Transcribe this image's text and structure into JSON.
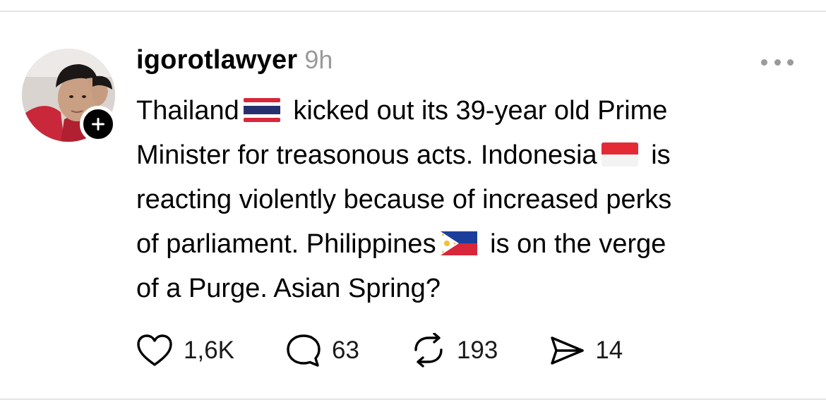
{
  "post": {
    "username": "igorotlawyer",
    "timestamp": "9h",
    "body_lines": [
      {
        "segments": [
          {
            "type": "text",
            "value": "Thailand"
          },
          {
            "type": "flag",
            "icon": "thailand-flag-icon"
          },
          {
            "type": "text",
            "value": " kicked out its 39-year old Prime"
          }
        ]
      },
      {
        "segments": [
          {
            "type": "text",
            "value": "Minister for treasonous acts. Indonesia"
          },
          {
            "type": "flag",
            "icon": "indonesia-flag-icon"
          },
          {
            "type": "text",
            "value": " is"
          }
        ]
      },
      {
        "segments": [
          {
            "type": "text",
            "value": "reacting violently because of increased perks"
          }
        ]
      },
      {
        "segments": [
          {
            "type": "text",
            "value": "of parliament. Philippines"
          },
          {
            "type": "flag",
            "icon": "philippines-flag-icon"
          },
          {
            "type": "text",
            "value": " is on the verge"
          }
        ]
      },
      {
        "segments": [
          {
            "type": "text",
            "value": "of a Purge. Asian Spring?"
          }
        ]
      }
    ],
    "line1_a": "Thailand",
    "line1_b": " kicked out its 39-year old Prime",
    "line2_a": "Minister for treasonous acts. Indonesia",
    "line2_b": " is",
    "line3": "reacting violently because of increased perks",
    "line4_a": "of parliament. Philippines",
    "line4_b": " is on the verge",
    "line5": "of a Purge. Asian Spring?"
  },
  "actions": {
    "like": {
      "icon": "heart-icon",
      "count": "1,6K"
    },
    "comment": {
      "icon": "comment-icon",
      "count": "63"
    },
    "repost": {
      "icon": "repost-icon",
      "count": "193"
    },
    "share": {
      "icon": "send-icon",
      "count": "14"
    }
  },
  "icons": {
    "avatar": "avatar",
    "follow": "plus-icon",
    "more": "more-icon"
  },
  "colors": {
    "text": "#000000",
    "muted": "#9a9a9a",
    "divider": "#e4e4e4"
  }
}
